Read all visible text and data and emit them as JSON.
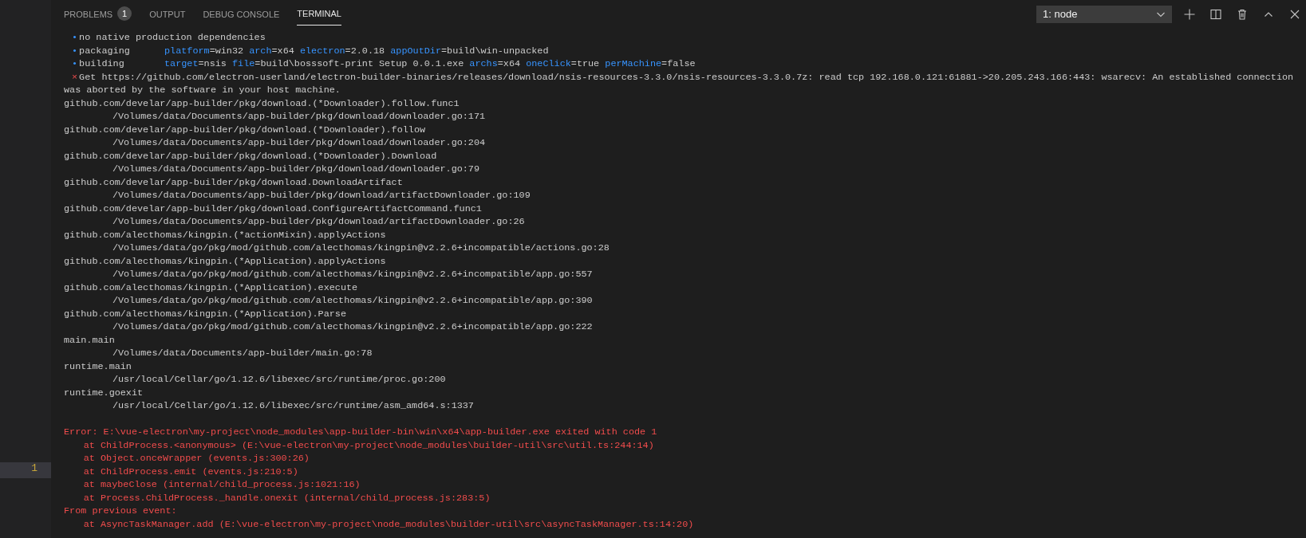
{
  "panel": {
    "tabs": [
      {
        "label": "PROBLEMS",
        "badge": "1",
        "selected": false
      },
      {
        "label": "OUTPUT",
        "selected": false
      },
      {
        "label": "DEBUG CONSOLE",
        "selected": false
      },
      {
        "label": "TERMINAL",
        "selected": true
      }
    ],
    "terminal_select": {
      "value": "1: node"
    }
  },
  "gutter": {
    "line_numbers": [
      {
        "number": "1",
        "selected": true
      }
    ]
  },
  "terminal": {
    "lines": [
      {
        "kind": "bullet",
        "marker": "•",
        "label": "no native production dependencies"
      },
      {
        "kind": "bullet",
        "marker": "•",
        "label": "packaging",
        "separator": "=",
        "fields": [
          {
            "key": "platform",
            "value": "win32"
          },
          {
            "key": "arch",
            "value": "x64"
          },
          {
            "key": "electron",
            "value": "2.0.18"
          },
          {
            "key": "appOutDir",
            "value": "build\\win-unpacked"
          }
        ]
      },
      {
        "kind": "bullet",
        "marker": "•",
        "label": "building",
        "separator": "=",
        "fields": [
          {
            "key": "target",
            "value": "nsis"
          },
          {
            "key": "file",
            "value": "build\\bosssoft-print Setup 0.0.1.exe"
          },
          {
            "key": "archs",
            "value": "x64"
          },
          {
            "key": "oneClick",
            "value": "true"
          },
          {
            "key": "perMachine",
            "value": "false"
          }
        ]
      },
      {
        "kind": "fail",
        "marker": "×",
        "label": "Get https://github.com/electron-userland/electron-builder-binaries/releases/download/nsis-resources-3.3.0/nsis-resources-3.3.0.7z: read tcp 192.168.0.121:61881->20.205.243.166:443: wsarecv: An established connection"
      },
      {
        "kind": "plain",
        "text": "was aborted by the software in your host machine."
      },
      {
        "kind": "plain",
        "text": "github.com/develar/app-builder/pkg/download.(*Downloader).follow.func1"
      },
      {
        "kind": "frame",
        "text": "/Volumes/data/Documents/app-builder/pkg/download/downloader.go:171"
      },
      {
        "kind": "plain",
        "text": "github.com/develar/app-builder/pkg/download.(*Downloader).follow"
      },
      {
        "kind": "frame",
        "text": "/Volumes/data/Documents/app-builder/pkg/download/downloader.go:204"
      },
      {
        "kind": "plain",
        "text": "github.com/develar/app-builder/pkg/download.(*Downloader).Download"
      },
      {
        "kind": "frame",
        "text": "/Volumes/data/Documents/app-builder/pkg/download/downloader.go:79"
      },
      {
        "kind": "plain",
        "text": "github.com/develar/app-builder/pkg/download.DownloadArtifact"
      },
      {
        "kind": "frame",
        "text": "/Volumes/data/Documents/app-builder/pkg/download/artifactDownloader.go:109"
      },
      {
        "kind": "plain",
        "text": "github.com/develar/app-builder/pkg/download.ConfigureArtifactCommand.func1"
      },
      {
        "kind": "frame",
        "text": "/Volumes/data/Documents/app-builder/pkg/download/artifactDownloader.go:26"
      },
      {
        "kind": "plain",
        "text": "github.com/alecthomas/kingpin.(*actionMixin).applyActions"
      },
      {
        "kind": "frame",
        "text": "/Volumes/data/go/pkg/mod/github.com/alecthomas/kingpin@v2.2.6+incompatible/actions.go:28"
      },
      {
        "kind": "plain",
        "text": "github.com/alecthomas/kingpin.(*Application).applyActions"
      },
      {
        "kind": "frame",
        "text": "/Volumes/data/go/pkg/mod/github.com/alecthomas/kingpin@v2.2.6+incompatible/app.go:557"
      },
      {
        "kind": "plain",
        "text": "github.com/alecthomas/kingpin.(*Application).execute"
      },
      {
        "kind": "frame",
        "text": "/Volumes/data/go/pkg/mod/github.com/alecthomas/kingpin@v2.2.6+incompatible/app.go:390"
      },
      {
        "kind": "plain",
        "text": "github.com/alecthomas/kingpin.(*Application).Parse"
      },
      {
        "kind": "frame",
        "text": "/Volumes/data/go/pkg/mod/github.com/alecthomas/kingpin@v2.2.6+incompatible/app.go:222"
      },
      {
        "kind": "plain",
        "text": "main.main"
      },
      {
        "kind": "frame",
        "text": "/Volumes/data/Documents/app-builder/main.go:78"
      },
      {
        "kind": "plain",
        "text": "runtime.main"
      },
      {
        "kind": "frame",
        "text": "/usr/local/Cellar/go/1.12.6/libexec/src/runtime/proc.go:200"
      },
      {
        "kind": "plain",
        "text": "runtime.goexit"
      },
      {
        "kind": "frame",
        "text": "/usr/local/Cellar/go/1.12.6/libexec/src/runtime/asm_amd64.s:1337"
      },
      {
        "kind": "blank"
      },
      {
        "kind": "error",
        "text": "Error: E:\\vue-electron\\my-project\\node_modules\\app-builder-bin\\win\\x64\\app-builder.exe exited with code 1"
      },
      {
        "kind": "error_at",
        "text": "at ChildProcess.<anonymous> (E:\\vue-electron\\my-project\\node_modules\\builder-util\\src\\util.ts:244:14)"
      },
      {
        "kind": "error_at",
        "text": "at Object.onceWrapper (events.js:300:26)"
      },
      {
        "kind": "error_at",
        "text": "at ChildProcess.emit (events.js:210:5)"
      },
      {
        "kind": "error_at",
        "text": "at maybeClose (internal/child_process.js:1021:16)"
      },
      {
        "kind": "error_at",
        "text": "at Process.ChildProcess._handle.onexit (internal/child_process.js:283:5)"
      },
      {
        "kind": "error",
        "text": "From previous event:"
      },
      {
        "kind": "error_at",
        "text": "at AsyncTaskManager.add (E:\\vue-electron\\my-project\\node_modules\\builder-util\\src\\asyncTaskManager.ts:14:20)"
      }
    ]
  }
}
